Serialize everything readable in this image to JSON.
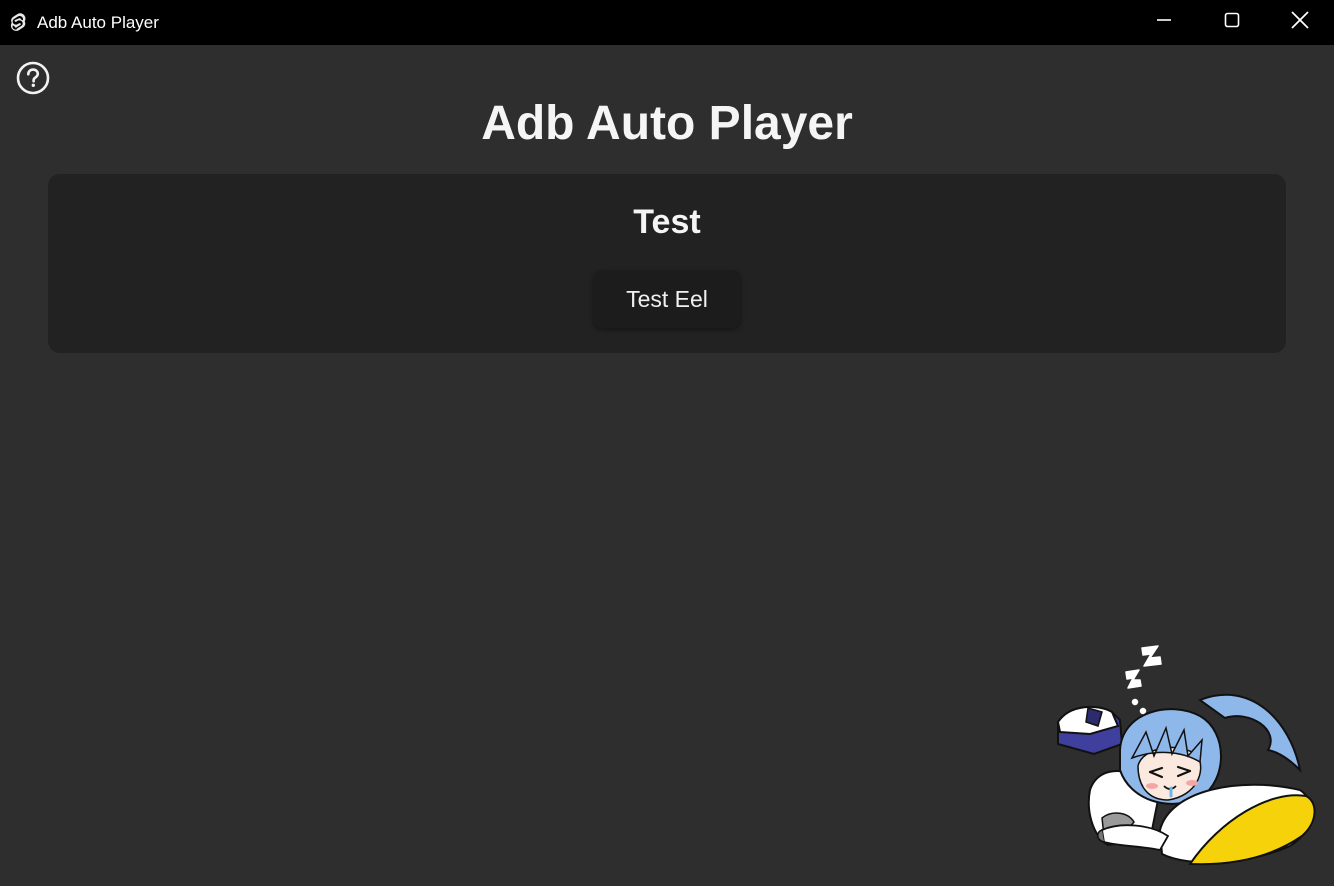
{
  "window": {
    "title": "Adb Auto Player",
    "app_icon": "svelte-logo-icon",
    "controls": [
      "minimize-icon",
      "maximize-icon",
      "close-icon"
    ]
  },
  "help": {
    "icon": "help-circle-icon"
  },
  "main": {
    "title": "Adb Auto Player",
    "card": {
      "title": "Test",
      "button_label": "Test Eel"
    }
  },
  "mascot": {
    "icon": "sleeping-chibi-mascot"
  },
  "colors": {
    "background": "#2e2e2e",
    "titlebar": "#000000",
    "card": "#222222",
    "button": "#1c1c1c",
    "text": "#f5f5f5",
    "mascot_hair": "#8fb8ea",
    "mascot_pillow": "#f5d20a"
  }
}
